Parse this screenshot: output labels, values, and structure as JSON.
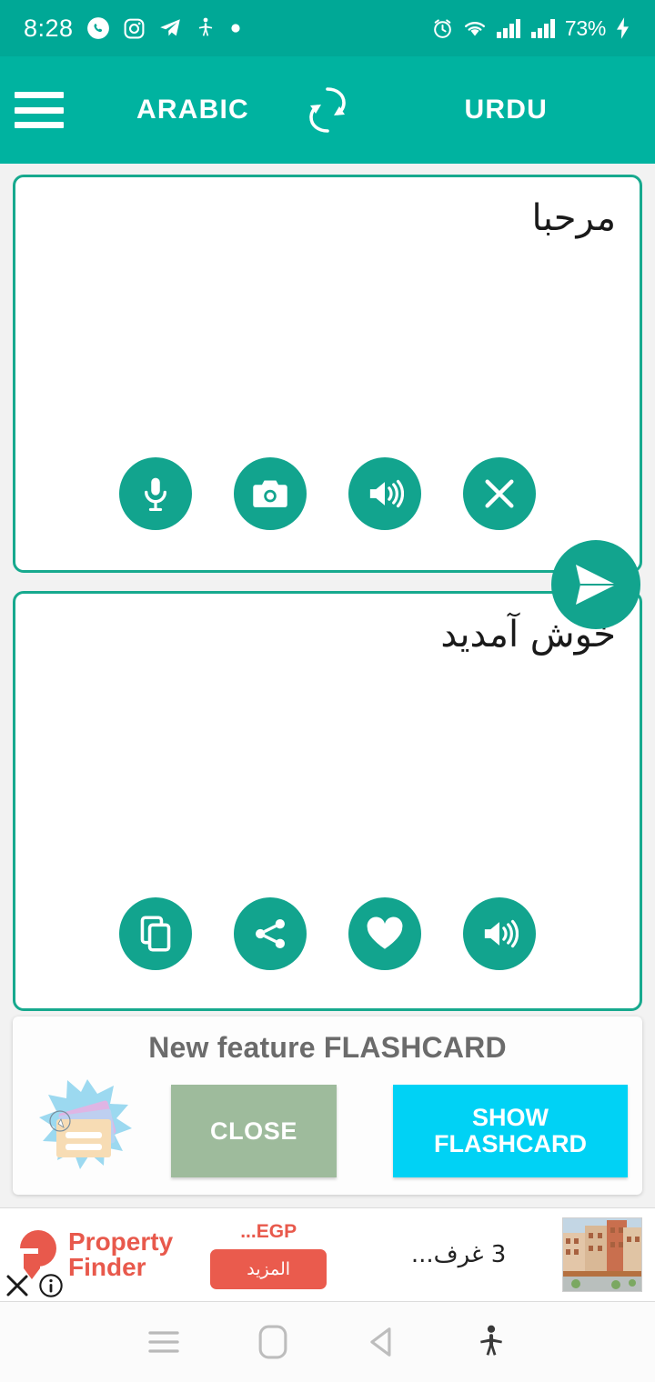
{
  "status_bar": {
    "time": "8:28",
    "battery": "73%",
    "left_icons": [
      "whatsapp-icon",
      "instagram-icon",
      "telegram-icon",
      "accessibility-icon",
      "dot-icon"
    ],
    "right_icons": [
      "alarm-icon",
      "wifi-icon",
      "signal-icon",
      "signal-icon",
      "charging-bolt-icon"
    ],
    "background": "#00a896"
  },
  "app_bar": {
    "menu_icon": "hamburger-menu-icon",
    "source_language": "ARABIC",
    "swap_icon": "swap-languages-icon",
    "target_language": "URDU",
    "background": "#00b3a0"
  },
  "source_card": {
    "text": "مرحبا",
    "actions": [
      {
        "name": "microphone-button",
        "icon": "microphone-icon"
      },
      {
        "name": "camera-button",
        "icon": "camera-icon"
      },
      {
        "name": "speak-button",
        "icon": "speaker-icon"
      },
      {
        "name": "clear-button",
        "icon": "close-x-icon"
      }
    ]
  },
  "send_button": {
    "name": "send-button",
    "icon": "send-paper-plane-icon"
  },
  "target_card": {
    "text": "خوش آمدید",
    "actions": [
      {
        "name": "copy-button",
        "icon": "copy-icon"
      },
      {
        "name": "share-button",
        "icon": "share-icon"
      },
      {
        "name": "favorite-button",
        "icon": "heart-icon"
      },
      {
        "name": "speak-button",
        "icon": "speaker-icon"
      }
    ]
  },
  "promo": {
    "title": "New feature FLASHCARD",
    "close_label": "CLOSE",
    "show_label_line1": "SHOW",
    "show_label_line2": "FLASHCARD",
    "illustration": "flashcard-burst-illustration",
    "close_color": "#9ebb9c",
    "show_color": "#00d2f5"
  },
  "ad": {
    "brand_line1": "Property",
    "brand_line2": "Finder",
    "price": "...EGP",
    "cta": "المزيد",
    "description": "3 غرف...",
    "thumbnail": "apartment-building-photo",
    "close_icon": "ad-close-icon",
    "info_icon": "ad-info-icon",
    "brand_color": "#e8594c"
  },
  "nav_bar": {
    "buttons": [
      {
        "name": "nav-recents-button",
        "icon": "recents-icon"
      },
      {
        "name": "nav-home-button",
        "icon": "home-icon"
      },
      {
        "name": "nav-back-button",
        "icon": "back-triangle-icon"
      },
      {
        "name": "nav-accessibility-button",
        "icon": "accessibility-icon"
      }
    ]
  },
  "theme": {
    "teal": "#00b3a0",
    "card_border": "#17a98e",
    "fab": "#12a48e"
  }
}
